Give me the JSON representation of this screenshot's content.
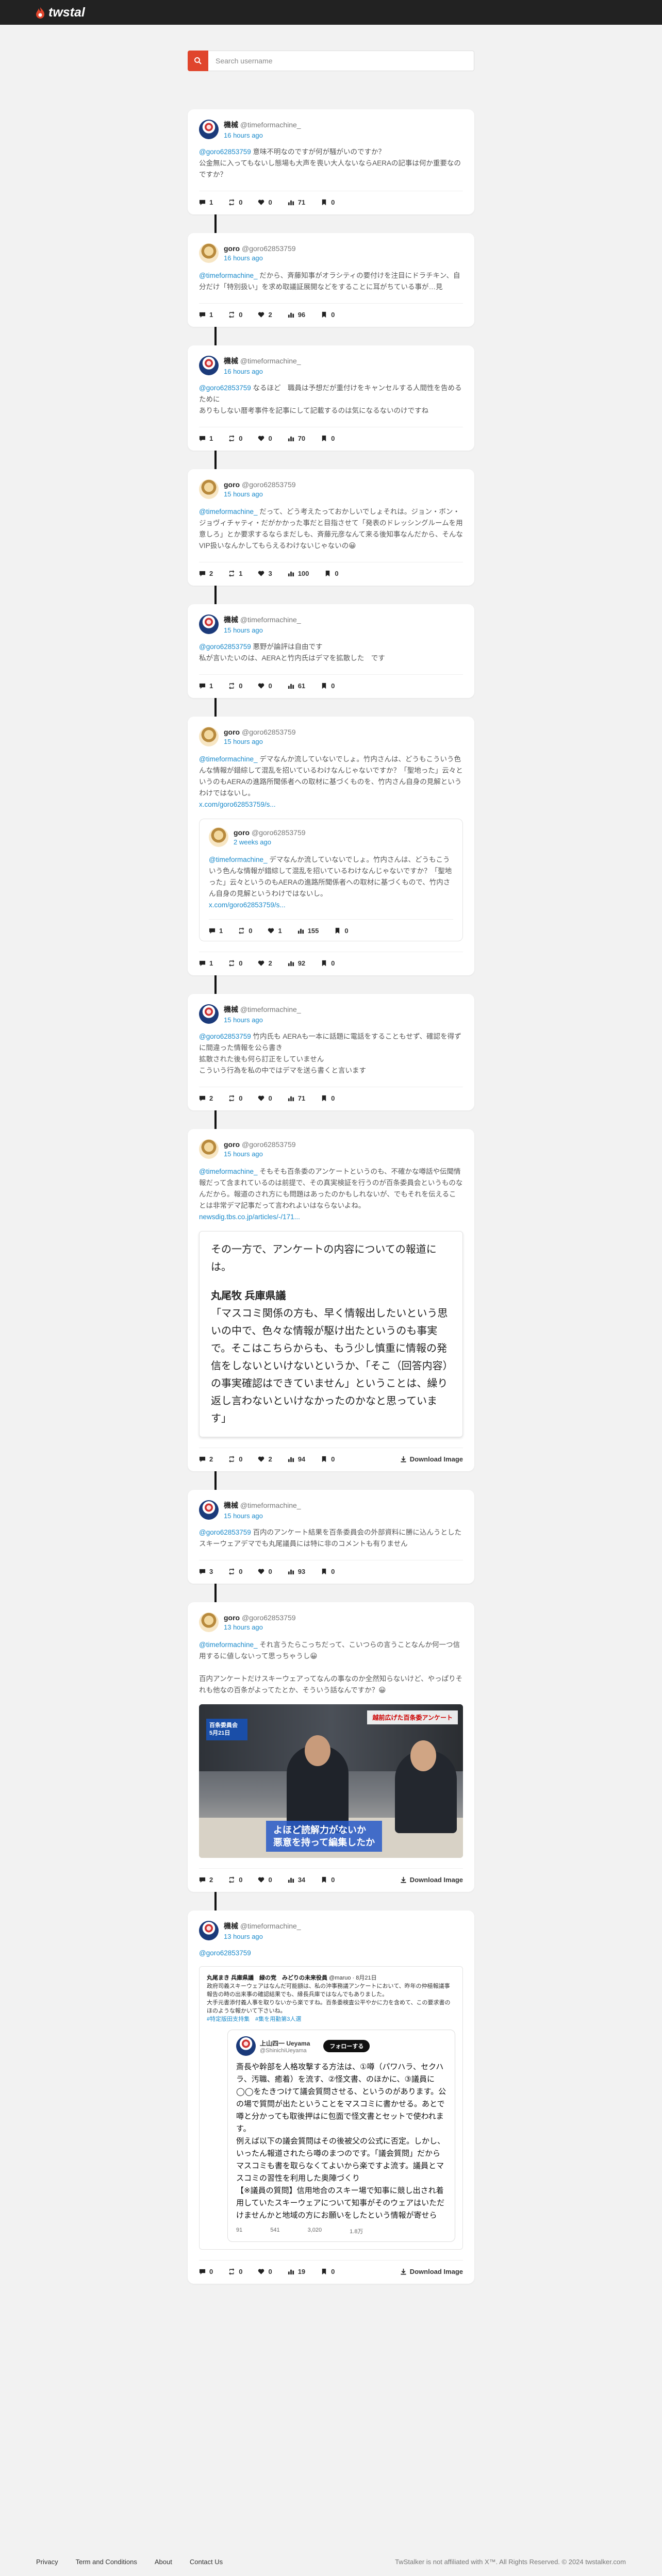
{
  "app": {
    "logo_text": "twstal",
    "accent": "#e0452c",
    "link_color": "#1a8acb"
  },
  "search": {
    "placeholder": "Search username"
  },
  "tweets": [
    {
      "name": "機械",
      "handle": "@timeformachine_",
      "time": "16 hours ago",
      "mention": "@goro62853759",
      "text": " 意味不明なのですが何が騒がいのですか？\n公金無に入ってもないし態場も大声を喪い大人ないならAERAの記事は何か重要なのですか？",
      "stats": {
        "replies": "1",
        "retweets": "0",
        "likes": "0",
        "views": "71",
        "bookmarks": "0"
      }
    },
    {
      "name": "goro",
      "handle": "@goro62853759",
      "time": "16 hours ago",
      "mention": "@timeformachine_",
      "text": " だから、斉藤知事がオラシティの要付けを注目にドラチキン、自分だけ「特別扱い」を求め取議証展開などをすることに耳がちている事が…見",
      "stats": {
        "replies": "1",
        "retweets": "0",
        "likes": "2",
        "views": "96",
        "bookmarks": "0"
      }
    },
    {
      "name": "機械",
      "handle": "@timeformachine_",
      "time": "16 hours ago",
      "mention": "@goro62853759",
      "text": " なるほど　職員は予想だが重付けをキャンセルする人間性を告めるために\nありもしない暦考事件を記事にして記載するのは気になるないのけですね",
      "stats": {
        "replies": "1",
        "retweets": "0",
        "likes": "0",
        "views": "70",
        "bookmarks": "0"
      }
    },
    {
      "name": "goro",
      "handle": "@goro62853759",
      "time": "15 hours ago",
      "mention": "@timeformachine_",
      "text": " だって、どう考えたっておかしいでしょそれは。ジョン・ボン・ジョヴィチャティ・だがかかった事だと目指させて「発表のドレッシングルームを用意しろ」とか要求するならまだしも、斉藤元彦なんて来る後知事なんだから、そんなVIP扱いなんかしてもらえるわけないじゃないの😀",
      "stats": {
        "replies": "2",
        "retweets": "1",
        "likes": "3",
        "views": "100",
        "bookmarks": "0"
      }
    },
    {
      "name": "機械",
      "handle": "@timeformachine_",
      "time": "15 hours ago",
      "mention": "@goro62853759",
      "text": " 悪野が論評は自由です\n私が言いたいのは、AERAと竹内氏はデマを拡散した　です",
      "stats": {
        "replies": "1",
        "retweets": "0",
        "likes": "0",
        "views": "61",
        "bookmarks": "0"
      }
    },
    {
      "name": "goro",
      "handle": "@goro62853759",
      "time": "15 hours ago",
      "mention": "@timeformachine_",
      "text": " デマなんか流していないでしょ。竹内さんは、どうもこういう色んな情報が錯綜して混乱を招いているわけなんじゃないですか？「聖地った」云々というのもAERAの進路所聞係者への取材に基づくものを、竹内さん自身の見解というわけではないし。",
      "link": "x.com/goro62853759/s...",
      "quote": {
        "name": "goro",
        "handle": "@goro62853759",
        "time": "2 weeks ago",
        "mention": "@timeformachine_",
        "text": " デマなんか流していないでしょ。竹内さんは、どうもこういう色んな情報が錯綜して混乱を招いているわけなんじゃないですか？「聖地った」云々というのもAERAの進路所聞係者への取材に基づくもので、竹内さん自身の見解というわけではないし。",
        "link": "x.com/goro62853759/s...",
        "stats": {
          "replies": "1",
          "retweets": "0",
          "likes": "1",
          "views": "155",
          "bookmarks": "0"
        }
      },
      "stats": {
        "replies": "1",
        "retweets": "0",
        "likes": "2",
        "views": "92",
        "bookmarks": "0"
      }
    },
    {
      "name": "機械",
      "handle": "@timeformachine_",
      "time": "15 hours ago",
      "mention": "@goro62853759",
      "text": " 竹内氏も AERAも一本に話題に電話をすることもせず、確認を得ずに間違った情報を公ら書き\n拡散された後も何ら訂正をしていません\nこういう行為を私の中ではデマを送ら書くと言います",
      "stats": {
        "replies": "2",
        "retweets": "0",
        "likes": "0",
        "views": "71",
        "bookmarks": "0"
      }
    },
    {
      "name": "goro",
      "handle": "@goro62853759",
      "time": "15 hours ago",
      "mention": "@timeformachine_",
      "text": " そもそも百条委のアンケートというのも、不確かな噂話や伝聞情報だって含まれているのは前提で、その真実検証を行うのが百条委員会というものなんだから。報道のされ方にも問題はあったのかもしれないが、でもそれを伝えることは非常デマ記事だって言われよいはならないよね。",
      "link": "newsdig.tbs.co.jp/articles/-/171...",
      "embed": {
        "p1": "その一方で、アンケートの内容についての報道には。",
        "heading": "丸尾牧 兵庫県議",
        "p2": "「マスコミ関係の方も、早く情報出したいという思いの中で、色々な情報が駆け出たというのも事実で。そこはこちらからも、もう少し慎重に情報の発信をしないといけないというか、「そこ（回答内容）の事実確認はできていません」ということは、繰り返し言わないといけなかったのかなと思っています」"
      },
      "download": "Download Image",
      "stats": {
        "replies": "2",
        "retweets": "0",
        "likes": "2",
        "views": "94",
        "bookmarks": "0"
      }
    },
    {
      "name": "機械",
      "handle": "@timeformachine_",
      "time": "15 hours ago",
      "mention": "@goro62853759",
      "text": " 百内のアンケート結果を百条委員会の外部資料に勝に込んうとしたスキーウェアデマでも丸尾議員には特に非のコメントも有りません",
      "stats": {
        "replies": "3",
        "retweets": "0",
        "likes": "0",
        "views": "93",
        "bookmarks": "0"
      }
    },
    {
      "name": "goro",
      "handle": "@goro62853759",
      "time": "13 hours ago",
      "mention": "@timeformachine_",
      "text": " それ言うたらこっちだって、こいつらの言うことなんか何一つ信用するに値しないって思っちゃうし😀\n\n百内アンケートだけスキーウェアってなんの事なのか全然知らないけど、やっぱりそれも他なの百条がよってたとか、そういう話なんですか？😀",
      "photo": {
        "badge": "百条委員会\n5月21日",
        "tag": "越前広げた百条委アンケート",
        "caption": "よほど読解力がないか\n悪意を持って編集したか"
      },
      "download": "Download Image",
      "stats": {
        "replies": "2",
        "retweets": "0",
        "likes": "0",
        "views": "34",
        "bookmarks": "0"
      }
    },
    {
      "name": "機械",
      "handle": "@timeformachine_",
      "time": "13 hours ago",
      "mention": "@goro62853759",
      "text": "",
      "shot": {
        "top": "丸尾まき 兵庫県議　緑の党　みどりの未来役員",
        "top_handle": "@maruo · 8月21日",
        "top_text": "政府司義スキーウェアはなんだ可能額は、私の沖事務議アンケートにおいて、昨年の仲極報議事報告の時の出来事の確認結果でも、縁長兵庫ではなんでもありました。\n大手元書添付義人事を取りないから楽ですね。百条委検査公平やかに力を含めて、この要求書のほのような報かいて下さいね。",
        "top_meta": "#特定版田支持集　#集を用勤第3人選",
        "inner_name": "上山四一 Ueyama",
        "inner_handle": "@ShinichiUeyama",
        "follow": "フォローする",
        "inner_text": "斎長や幹部を人格攻撃する方法は、①噂（パワハラ、セクハラ、汚職、癒着）を流す、②怪文書、のほかに、③議員に◯◯をたきつけて議会質問させる、というのがあります。公の場で質問が出たということをマスコミに書かせる。あとで噂と分かっても取後押はに包面で怪文書とセットで使われます。\n例えば以下の議会質問はその後被父の公式に否定。しかし、いったん報道されたら噂のまつのです。「議会質問」だからマスコミも書を取らなくてよいから楽ですよ流す。議員とマスコミの習性を利用した奥陣づくり\n【※議員の質問】信用地合のスキー場で知事に競し出され着用していたスキーウェアについて知事がそのウェアはいただけませんかと地域の方にお願いをしたという情報が寄せら",
        "shot_stats": [
          "91",
          "541",
          "3,020",
          "1.8万"
        ]
      },
      "download": "Download Image",
      "stats": {
        "replies": "0",
        "retweets": "0",
        "likes": "0",
        "views": "19",
        "bookmarks": "0"
      }
    }
  ],
  "footer": {
    "links": [
      "Privacy",
      "Term and Conditions",
      "About",
      "Contact Us"
    ],
    "copyright": "TwStalker is not affiliated with X™. All Rights Reserved. © 2024 twstalker.com"
  }
}
